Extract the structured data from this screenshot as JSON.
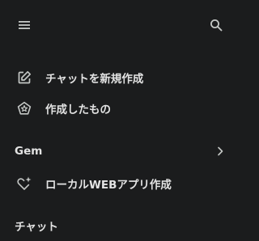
{
  "sidebar": {
    "menu_icon": "menu-icon",
    "search_icon": "search-icon",
    "items": [
      {
        "label": "チャットを新規作成",
        "icon": "edit-square-icon"
      },
      {
        "label": "作成したもの",
        "icon": "pentagon-star-icon"
      }
    ],
    "gem_section": {
      "title": "Gem",
      "chevron_icon": "chevron-right-icon",
      "items": [
        {
          "label": "ローカルWEBアプリ作成",
          "icon": "heart-sparkle-icon"
        }
      ]
    },
    "chat_section": {
      "title": "チャット"
    }
  },
  "colors": {
    "background": "#1b1c1d",
    "text": "#e3e3e3",
    "icon": "#c4c7c5"
  }
}
